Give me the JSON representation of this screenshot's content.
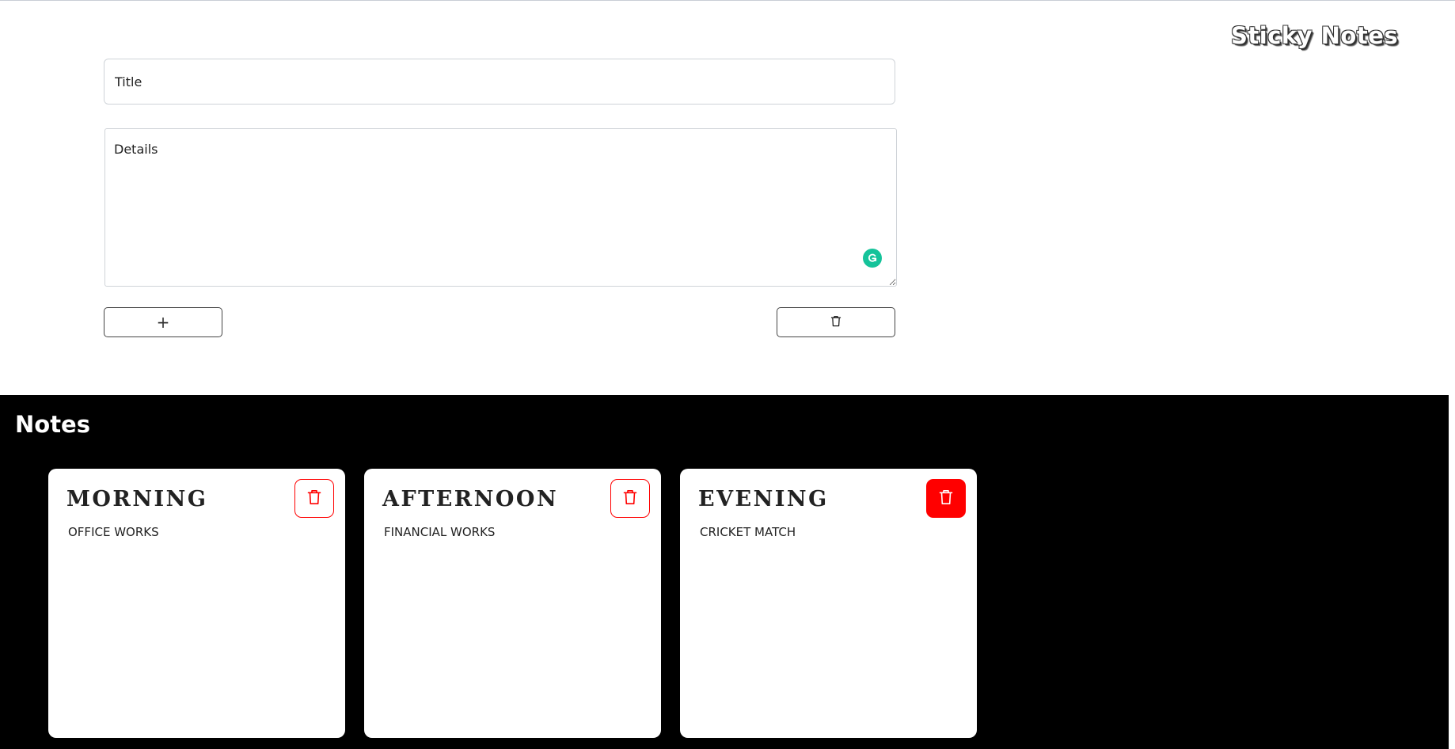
{
  "app": {
    "title": "Sticky Notes"
  },
  "form": {
    "title_placeholder": "Title",
    "details_placeholder": "Details",
    "add_label": "+"
  },
  "notes_section": {
    "heading": "Notes",
    "items": [
      {
        "title": "MORNING",
        "body": "OFFICE WORKS",
        "delete_icon": "trash-icon",
        "delete_active": false
      },
      {
        "title": "AFTERNOON",
        "body": "FINANCIAL WORKS",
        "delete_icon": "trash-icon",
        "delete_active": false
      },
      {
        "title": "EVENING",
        "body": "CRICKET MATCH",
        "delete_icon": "trash-icon",
        "delete_active": true
      }
    ]
  },
  "colors": {
    "notes_background": "#000000",
    "card_background": "#ffffff",
    "delete_accent": "#ff0000",
    "grammarly": "#15c39a"
  },
  "icons": {
    "add": "plus-icon",
    "clear": "trash-icon",
    "grammarly": "grammarly-icon"
  }
}
